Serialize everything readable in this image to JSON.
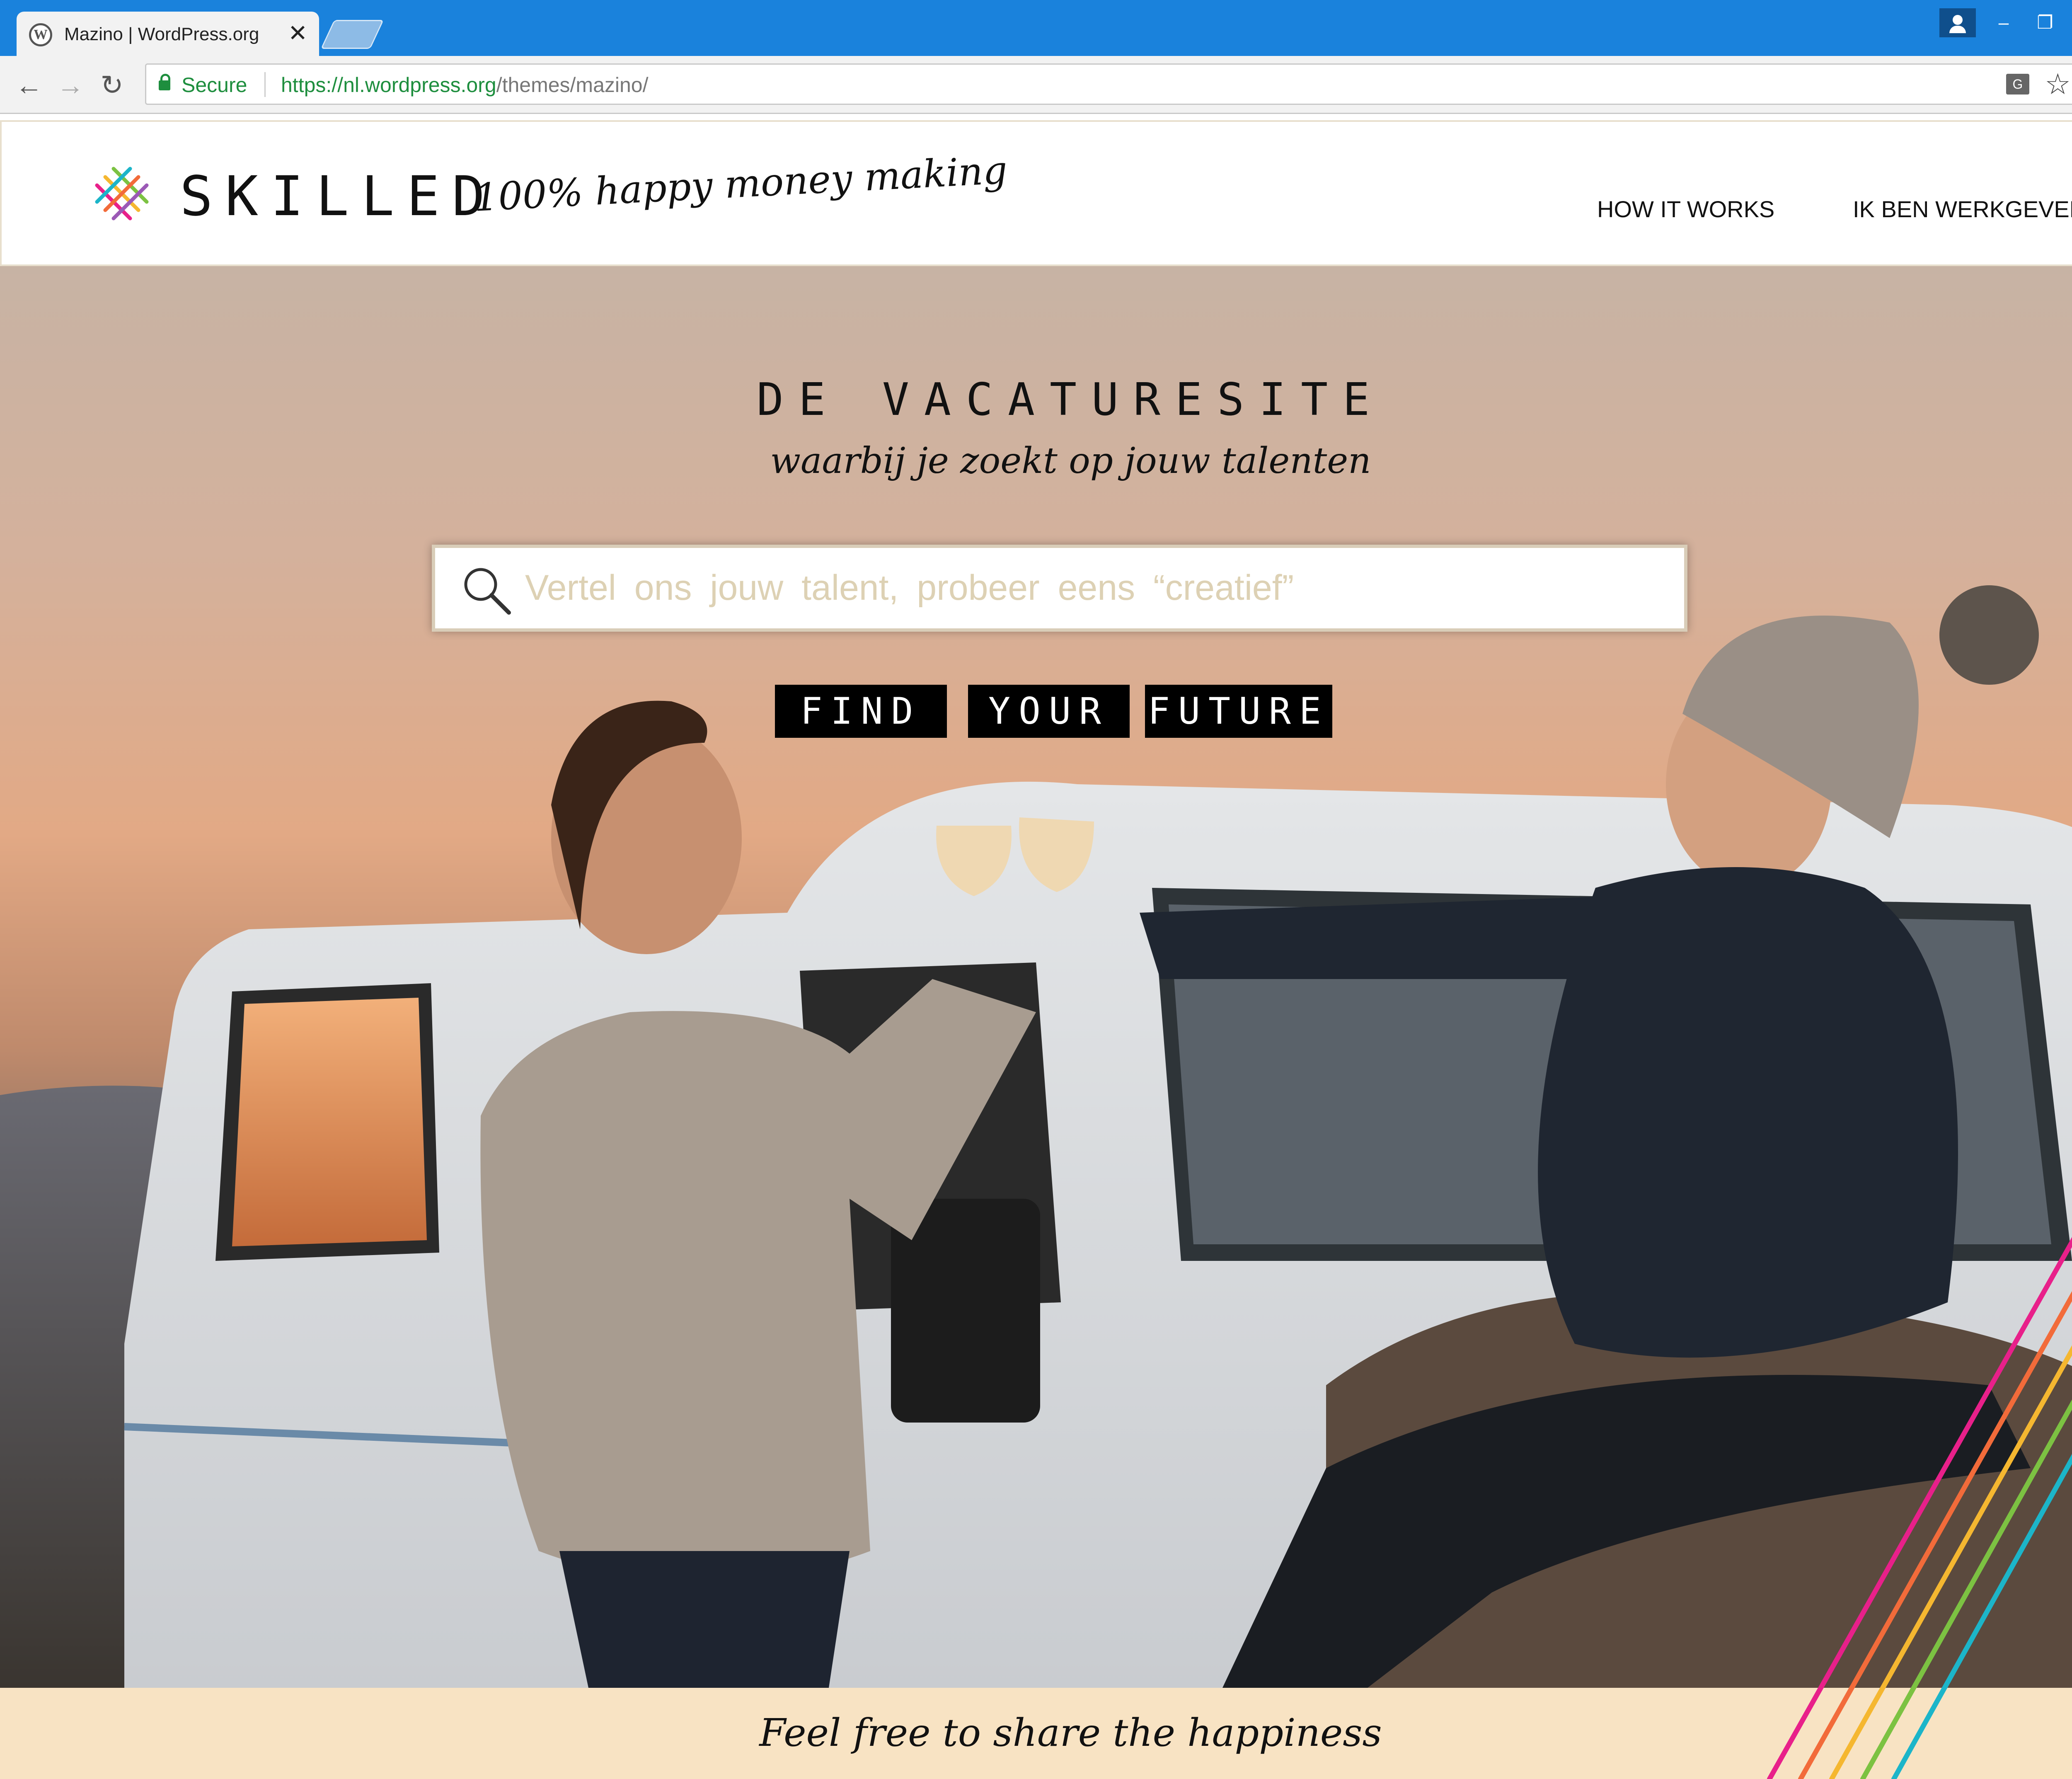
{
  "browser": {
    "tab_title": "Mazino | WordPress.org",
    "tab_close": "✕",
    "favicon_letter": "W",
    "security_label": "Secure",
    "url_host": "https://nl.wordpress.org",
    "url_path": "/themes/mazino/",
    "translate_glyph": "G",
    "window_min": "–",
    "window_max": "❐",
    "window_close": "✕",
    "back": "←",
    "forward": "→",
    "reload": "↻",
    "bookmark": "☆",
    "menu": "⋮"
  },
  "site": {
    "logo": "SKILLED",
    "tagline": "100% happy money making",
    "nav": [
      "HOW IT WORKS",
      "IK BEN WERKGEVER"
    ]
  },
  "hero": {
    "title": "DE VACATURESITE",
    "subtitle": "waarbij je zoekt op jouw talenten",
    "search_placeholder": "Vertel ons jouw talent, probeer eens “creatief”",
    "cta_words": [
      "FIND",
      "YOUR",
      "FUTURE"
    ]
  },
  "footer": {
    "text": "Feel free to share the happiness"
  },
  "colors": {
    "chrome_blue": "#1a82dc",
    "footer_bg": "#f8e3c3",
    "rainbow": [
      "#e8208a",
      "#f26b3a",
      "#f5b730",
      "#7cc242",
      "#1cb5c9"
    ]
  }
}
